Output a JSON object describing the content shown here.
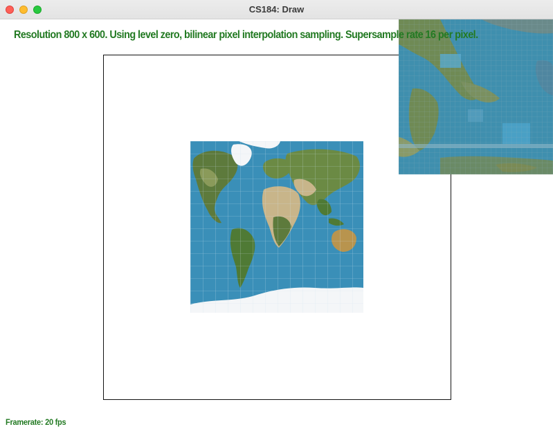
{
  "window": {
    "title": "CS184: Draw"
  },
  "status": {
    "text": "Resolution 800 x 600. Using level zero, bilinear pixel interpolation sampling. Supersample rate 16 per pixel."
  },
  "footer": {
    "framerate": "Framerate: 20 fps"
  },
  "colors": {
    "status_text": "#237a23",
    "ocean": "#3a8fb8",
    "land_green": "#5d7a3c",
    "land_desert": "#c8b58a",
    "ice": "#f4f6f8"
  },
  "icons": {
    "close": "close-traffic-light-icon",
    "minimize": "minimize-traffic-light-icon",
    "maximize": "maximize-traffic-light-icon"
  }
}
